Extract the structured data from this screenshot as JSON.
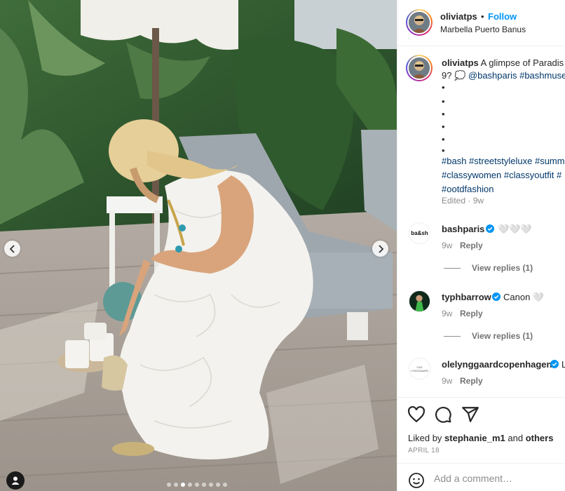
{
  "post": {
    "username": "oliviatps",
    "separator": "•",
    "follow_label": "Follow",
    "location": "Marbella Puerto Banus"
  },
  "media": {
    "carousel_count": 9,
    "carousel_active_index": 3,
    "icons": {
      "prev": "chevron-left-icon",
      "next": "chevron-right-icon",
      "tags": "user-tag-icon"
    }
  },
  "caption": {
    "username": "oliviatps",
    "line1": "A glimpse of Paradis",
    "line2_prefix": "9? 💭",
    "mention1": "@bashparis",
    "mention2": "#bashmuse",
    "bullets": [
      "•",
      "•",
      "•",
      "•",
      "•",
      "•"
    ],
    "hashtags_line1": "#bash #streetstyleluxe #summ",
    "hashtags_line2": "#classywomen #classyoutfit #",
    "hashtags_line3": "#ootdfashion",
    "edited": "Edited · 9w"
  },
  "comments": [
    {
      "username": "bashparis",
      "avatar_text": "ba&sh",
      "text": "🤍🤍🤍",
      "age": "9w",
      "reply_label": "Reply",
      "view_replies": "View replies (1)",
      "verified": true
    },
    {
      "username": "typhbarrow",
      "avatar_text": "",
      "text": "Canon 🤍",
      "age": "9w",
      "reply_label": "Reply",
      "view_replies": "View replies (1)",
      "verified": true
    },
    {
      "username": "olelynggaardcopenhagen",
      "avatar_text": "OLE LYNGGAARD",
      "text": "L",
      "age": "9w",
      "reply_label": "Reply",
      "verified": true
    }
  ],
  "actions": {
    "icons": [
      "heart-icon",
      "comment-icon",
      "share-icon"
    ],
    "liked_prefix": "Liked by",
    "liked_user": "stephanie_m1",
    "liked_and": "and",
    "liked_others": "others",
    "date": "APRIL 18"
  },
  "composer": {
    "placeholder": "Add a comment…",
    "emoji_icon": "emoji-icon"
  },
  "colors": {
    "accent": "#0095f6",
    "link": "#00376b",
    "muted": "#8e8e8e",
    "verified": "#0095f6"
  }
}
